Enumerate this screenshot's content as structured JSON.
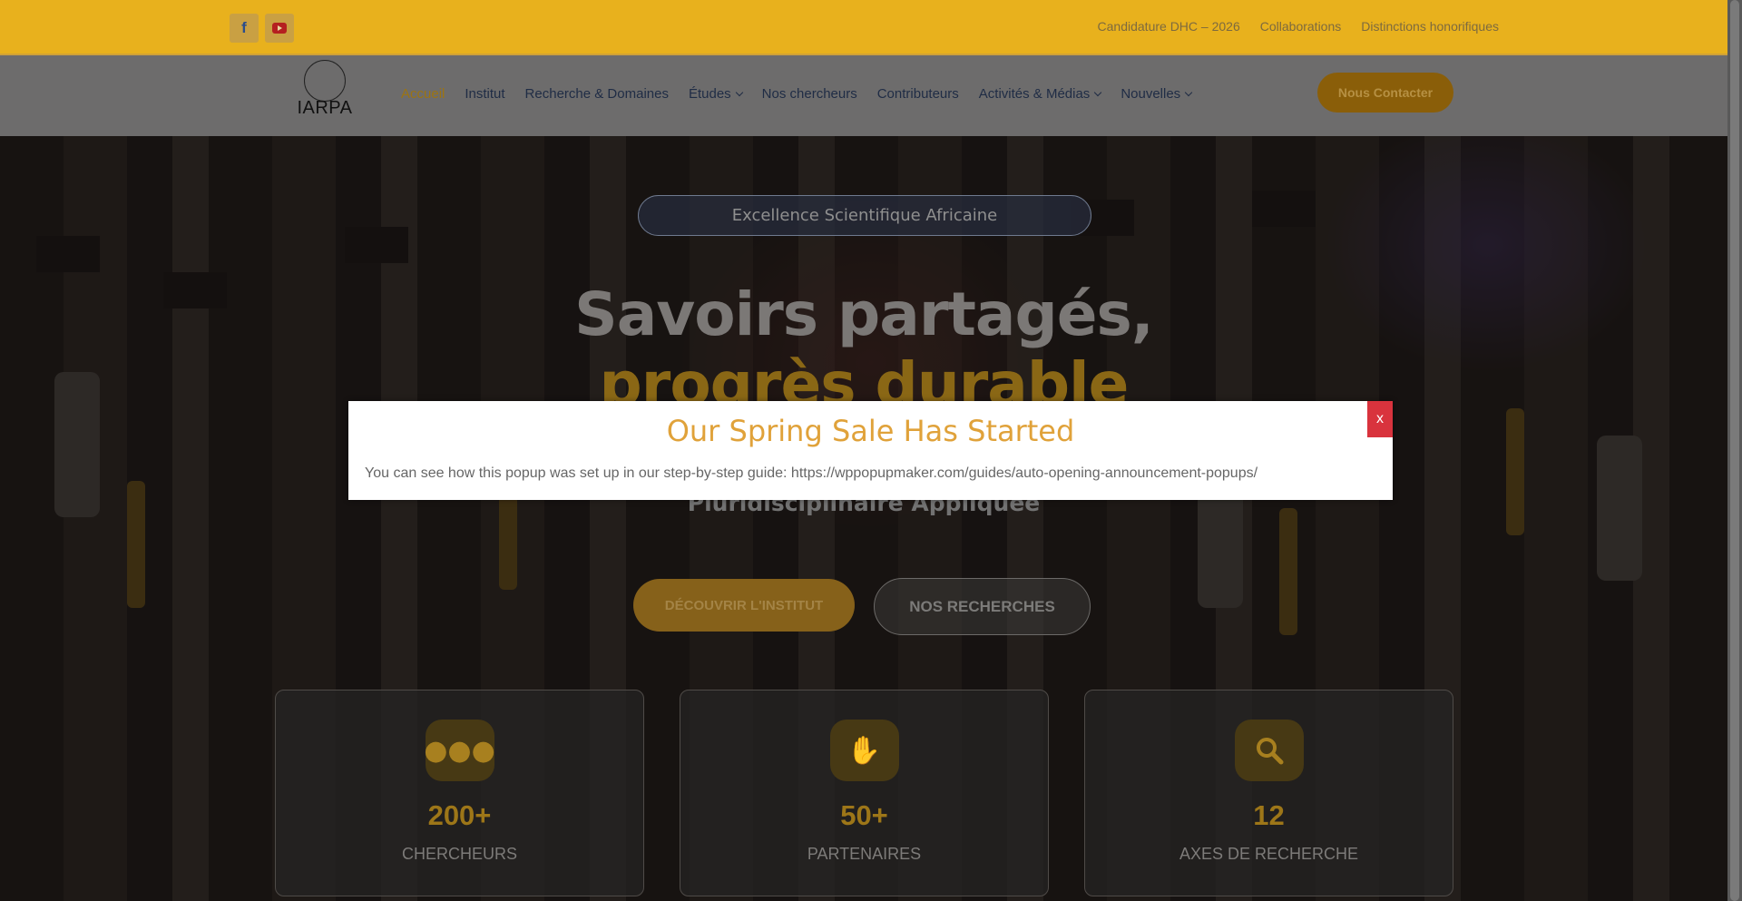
{
  "topbar": {
    "links": [
      "Candidature DHC – 2026",
      "Collaborations",
      "Distinctions honorifiques"
    ],
    "social": [
      "facebook-icon",
      "youtube-icon"
    ]
  },
  "logo": {
    "text": "IARPA"
  },
  "nav": {
    "items": [
      {
        "label": "Accueil",
        "active": true,
        "dropdown": false
      },
      {
        "label": "Institut",
        "dropdown": false
      },
      {
        "label": "Recherche & Domaines",
        "dropdown": false
      },
      {
        "label": "Études",
        "dropdown": true
      },
      {
        "label": "Nos chercheurs",
        "dropdown": false
      },
      {
        "label": "Contributeurs",
        "dropdown": false
      },
      {
        "label": "Activités & Médias",
        "dropdown": true
      },
      {
        "label": "Nouvelles",
        "dropdown": true
      }
    ],
    "contact_label": "Nous Contacter"
  },
  "hero": {
    "badge": "Excellence Scientifique Africaine",
    "title_line1": "Savoirs partagés,",
    "title_line2": "progrès durable",
    "subtitle": "Pluridisciplinaire Appliquée",
    "primary_button": "DÉCOUVRIR L'INSTITUT",
    "secondary_button": "NOS RECHERCHES"
  },
  "stats": [
    {
      "icon": "users-icon",
      "value": "200+",
      "label": "CHERCHEURS"
    },
    {
      "icon": "handshake-icon",
      "value": "50+",
      "label": "PARTENAIRES"
    },
    {
      "icon": "search-icon",
      "value": "12",
      "label": "AXES DE RECHERCHE"
    }
  ],
  "popup": {
    "title": "Our Spring Sale Has Started",
    "body": "You can see how this popup was set up in our step-by-step guide: https://wppopupmaker.com/guides/auto-opening-announcement-popups/",
    "close_label": "x"
  },
  "colors": {
    "topbar": "#e8b11d",
    "accent": "#e0a23a",
    "close": "#d9333d"
  }
}
